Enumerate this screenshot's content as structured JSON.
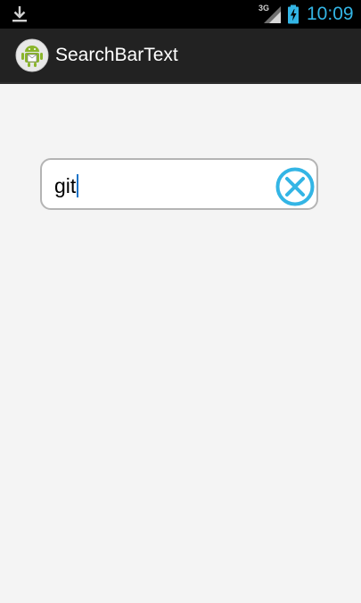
{
  "status_bar": {
    "network_label": "3G",
    "time": "10:09",
    "accent_color": "#33b5e5",
    "icons": [
      "download-icon",
      "signal-icon",
      "battery-charging-icon"
    ]
  },
  "action_bar": {
    "title": "SearchBarText",
    "icon": "android-app-icon"
  },
  "search": {
    "value": "git",
    "clear_icon": "clear-circle-x-icon",
    "clear_icon_color": "#33b5e5"
  }
}
